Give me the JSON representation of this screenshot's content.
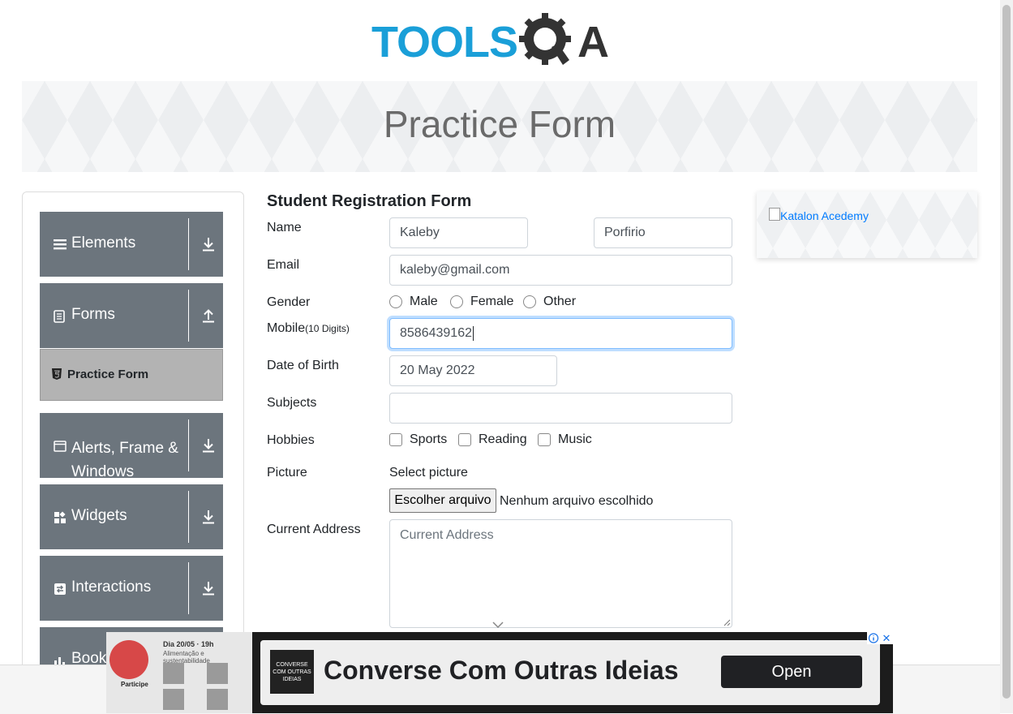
{
  "logo": {
    "part1": "TOOLS",
    "part2": "A"
  },
  "banner": {
    "title": "Practice Form"
  },
  "sidebar": {
    "groups": [
      {
        "label": "Elements",
        "icon": "list-icon",
        "arrow": "download-arrow"
      },
      {
        "label": "Forms",
        "icon": "document-icon",
        "arrow": "upload-arrow"
      },
      {
        "label": "Alerts, Frame & Windows",
        "icon": "window-icon",
        "arrow": "download-arrow"
      },
      {
        "label": "Widgets",
        "icon": "widgets-icon",
        "arrow": "download-arrow"
      },
      {
        "label": "Interactions",
        "icon": "swap-icon",
        "arrow": "download-arrow"
      },
      {
        "label": "Book",
        "icon": "chart-icon"
      }
    ],
    "active_item": {
      "label": "Practice Form",
      "icon": "html5-icon"
    },
    "colors": {
      "group_bg": "#6c757d",
      "active_bg": "#b3b3b3"
    }
  },
  "form": {
    "title": "Student Registration Form",
    "labels": {
      "name": "Name",
      "email": "Email",
      "gender": "Gender",
      "mobile": "Mobile",
      "mobile_hint": "(10 Digits)",
      "dob": "Date of Birth",
      "subjects": "Subjects",
      "hobbies": "Hobbies",
      "picture": "Picture",
      "address": "Current Address"
    },
    "first_name": "Kaleby",
    "last_name": "Porfirio",
    "email": "kaleby@gmail.com",
    "genders": [
      "Male",
      "Female",
      "Other"
    ],
    "mobile": "8586439162",
    "dob": "20 May 2022",
    "subjects": "",
    "hobbies": [
      "Sports",
      "Reading",
      "Music"
    ],
    "picture_caption": "Select picture",
    "file_button": "Escolher arquivo",
    "file_status": "Nenhum arquivo escolhido",
    "address_placeholder": "Current Address"
  },
  "side_ad": {
    "alt": "Katalon Acedemy"
  },
  "bottom_ad": {
    "promo_line1": "Dia 20/05 · 19h",
    "promo_line2": "Alimentação e sustentabilidade",
    "promo_cta": "Participe",
    "brand_text": "CONVERSE COM OUTRAS IDEIAS",
    "headline": "Converse Com Outras Ideias",
    "cta": "Open",
    "close": "✕"
  },
  "colors": {
    "accent": "#1a9fd8",
    "focus": "#80bdff"
  }
}
